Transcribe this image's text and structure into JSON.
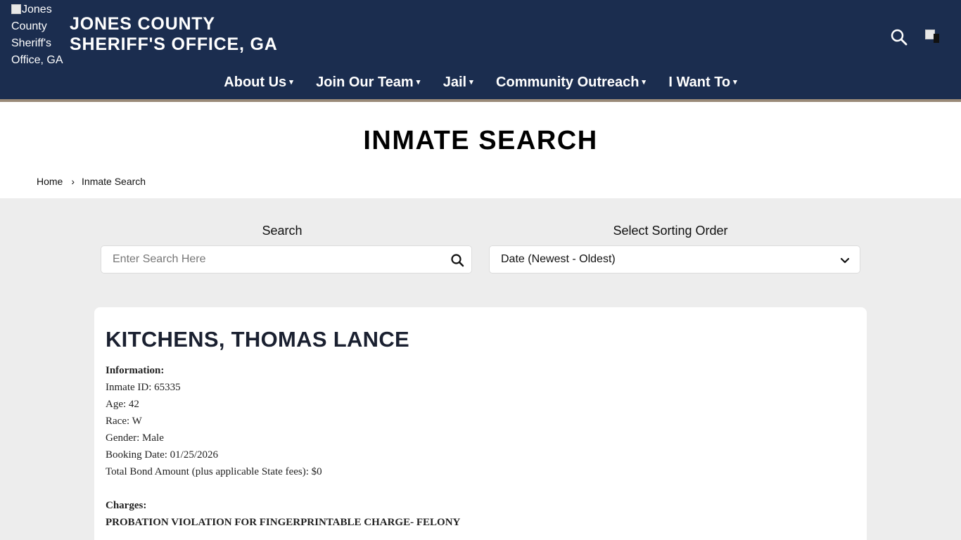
{
  "header": {
    "logo_alt": "Jones County Sheriff's Office, GA",
    "site_title_line1": "JONES COUNTY",
    "site_title_line2": "SHERIFF'S OFFICE, GA",
    "search_icon": "search-icon",
    "flag_icon": "broken-image-icon"
  },
  "nav": {
    "items": [
      {
        "label": "About Us"
      },
      {
        "label": "Join Our Team"
      },
      {
        "label": "Jail"
      },
      {
        "label": "Community Outreach"
      },
      {
        "label": "I Want To"
      }
    ],
    "caret": "▾"
  },
  "page": {
    "title": "INMATE SEARCH",
    "breadcrumb": {
      "home": "Home",
      "separator": "›",
      "current": "Inmate Search"
    }
  },
  "search": {
    "label": "Search",
    "placeholder": "Enter Search Here",
    "value": "",
    "sort_label": "Select Sorting Order",
    "sort_value": "Date (Newest - Oldest)"
  },
  "inmate": {
    "name": "KITCHENS, THOMAS LANCE",
    "info_heading": "Information:",
    "id_line": "Inmate ID: 65335",
    "age_line": "Age: 42",
    "race_line": "Race: W",
    "gender_line": "Gender: Male",
    "booking_line": "Booking Date: 01/25/2026",
    "bond_line": "Total Bond Amount (plus applicable State fees): $0",
    "charges_heading": "Charges:",
    "charge_1": "PROBATION VIOLATION FOR FINGERPRINTABLE CHARGE- FELONY"
  },
  "colors": {
    "header_bg": "#1b2d4f",
    "header_border": "#9a8a78",
    "page_bg": "#ededed"
  }
}
